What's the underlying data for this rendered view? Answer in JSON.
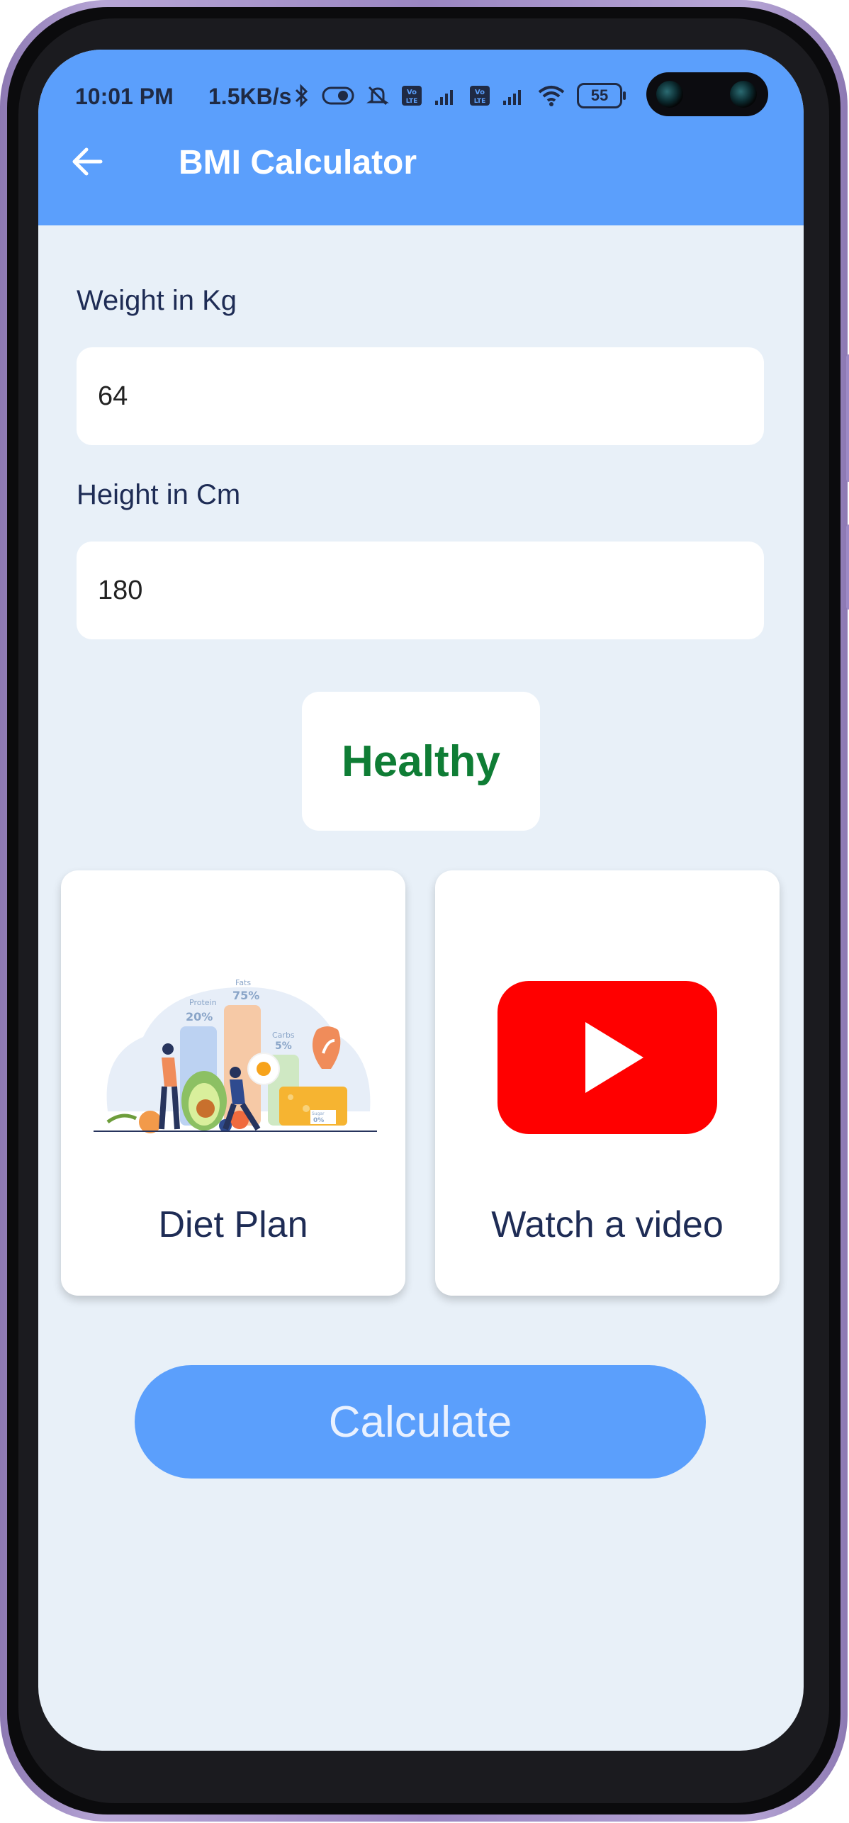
{
  "status_bar": {
    "time": "10:01 PM",
    "net_speed": "1.5KB/s",
    "battery": "55",
    "icons": [
      "bluetooth-icon",
      "toggle-icon",
      "mute-icon",
      "volte-icon",
      "signal-icon",
      "volte-icon",
      "signal-icon",
      "wifi-icon",
      "battery-icon"
    ]
  },
  "app_bar": {
    "title": "BMI Calculator",
    "back_icon": "arrow-left-icon",
    "background": "#5b9ffc"
  },
  "form": {
    "weight_label": "Weight in Kg",
    "weight_value": "64",
    "height_label": "Height in Cm",
    "height_value": "180"
  },
  "result": {
    "text": "Healthy",
    "color": "#0f7d35"
  },
  "cards": [
    {
      "label": "Diet Plan",
      "icon": "diet-illustration",
      "illustration_text": [
        "Protein",
        "20%",
        "Fats",
        "75%",
        "Carbs",
        "5%",
        "Sugar",
        "0%"
      ]
    },
    {
      "label": "Watch a video",
      "icon": "youtube-play-icon"
    }
  ],
  "calculate_button": {
    "label": "Calculate"
  },
  "colors": {
    "accent": "#5b9ffc",
    "background": "#e8f0f8",
    "text": "#1e2c55",
    "youtube_red": "#ff0000"
  }
}
